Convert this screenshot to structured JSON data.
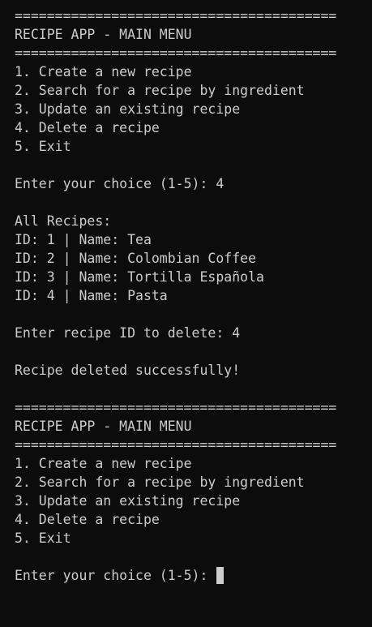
{
  "terminal": {
    "lines": [
      "========================================",
      "RECIPE APP - MAIN MENU",
      "========================================",
      "1. Create a new recipe",
      "2. Search for a recipe by ingredient",
      "3. Update an existing recipe",
      "4. Delete a recipe",
      "5. Exit",
      "",
      "Enter your choice (1-5): 4",
      "",
      "All Recipes:",
      "ID: 1 | Name: Tea",
      "ID: 2 | Name: Colombian Coffee",
      "ID: 3 | Name: Tortilla Española",
      "ID: 4 | Name: Pasta",
      "",
      "Enter recipe ID to delete: 4",
      "",
      "Recipe deleted successfully!",
      "",
      "========================================",
      "RECIPE APP - MAIN MENU",
      "========================================",
      "1. Create a new recipe",
      "2. Search for a recipe by ingredient",
      "3. Update an existing recipe",
      "4. Delete a recipe",
      "5. Exit",
      "",
      "Enter your choice (1-5): "
    ]
  },
  "colors": {
    "background": "#0c0c0c",
    "foreground": "#cccccc"
  }
}
